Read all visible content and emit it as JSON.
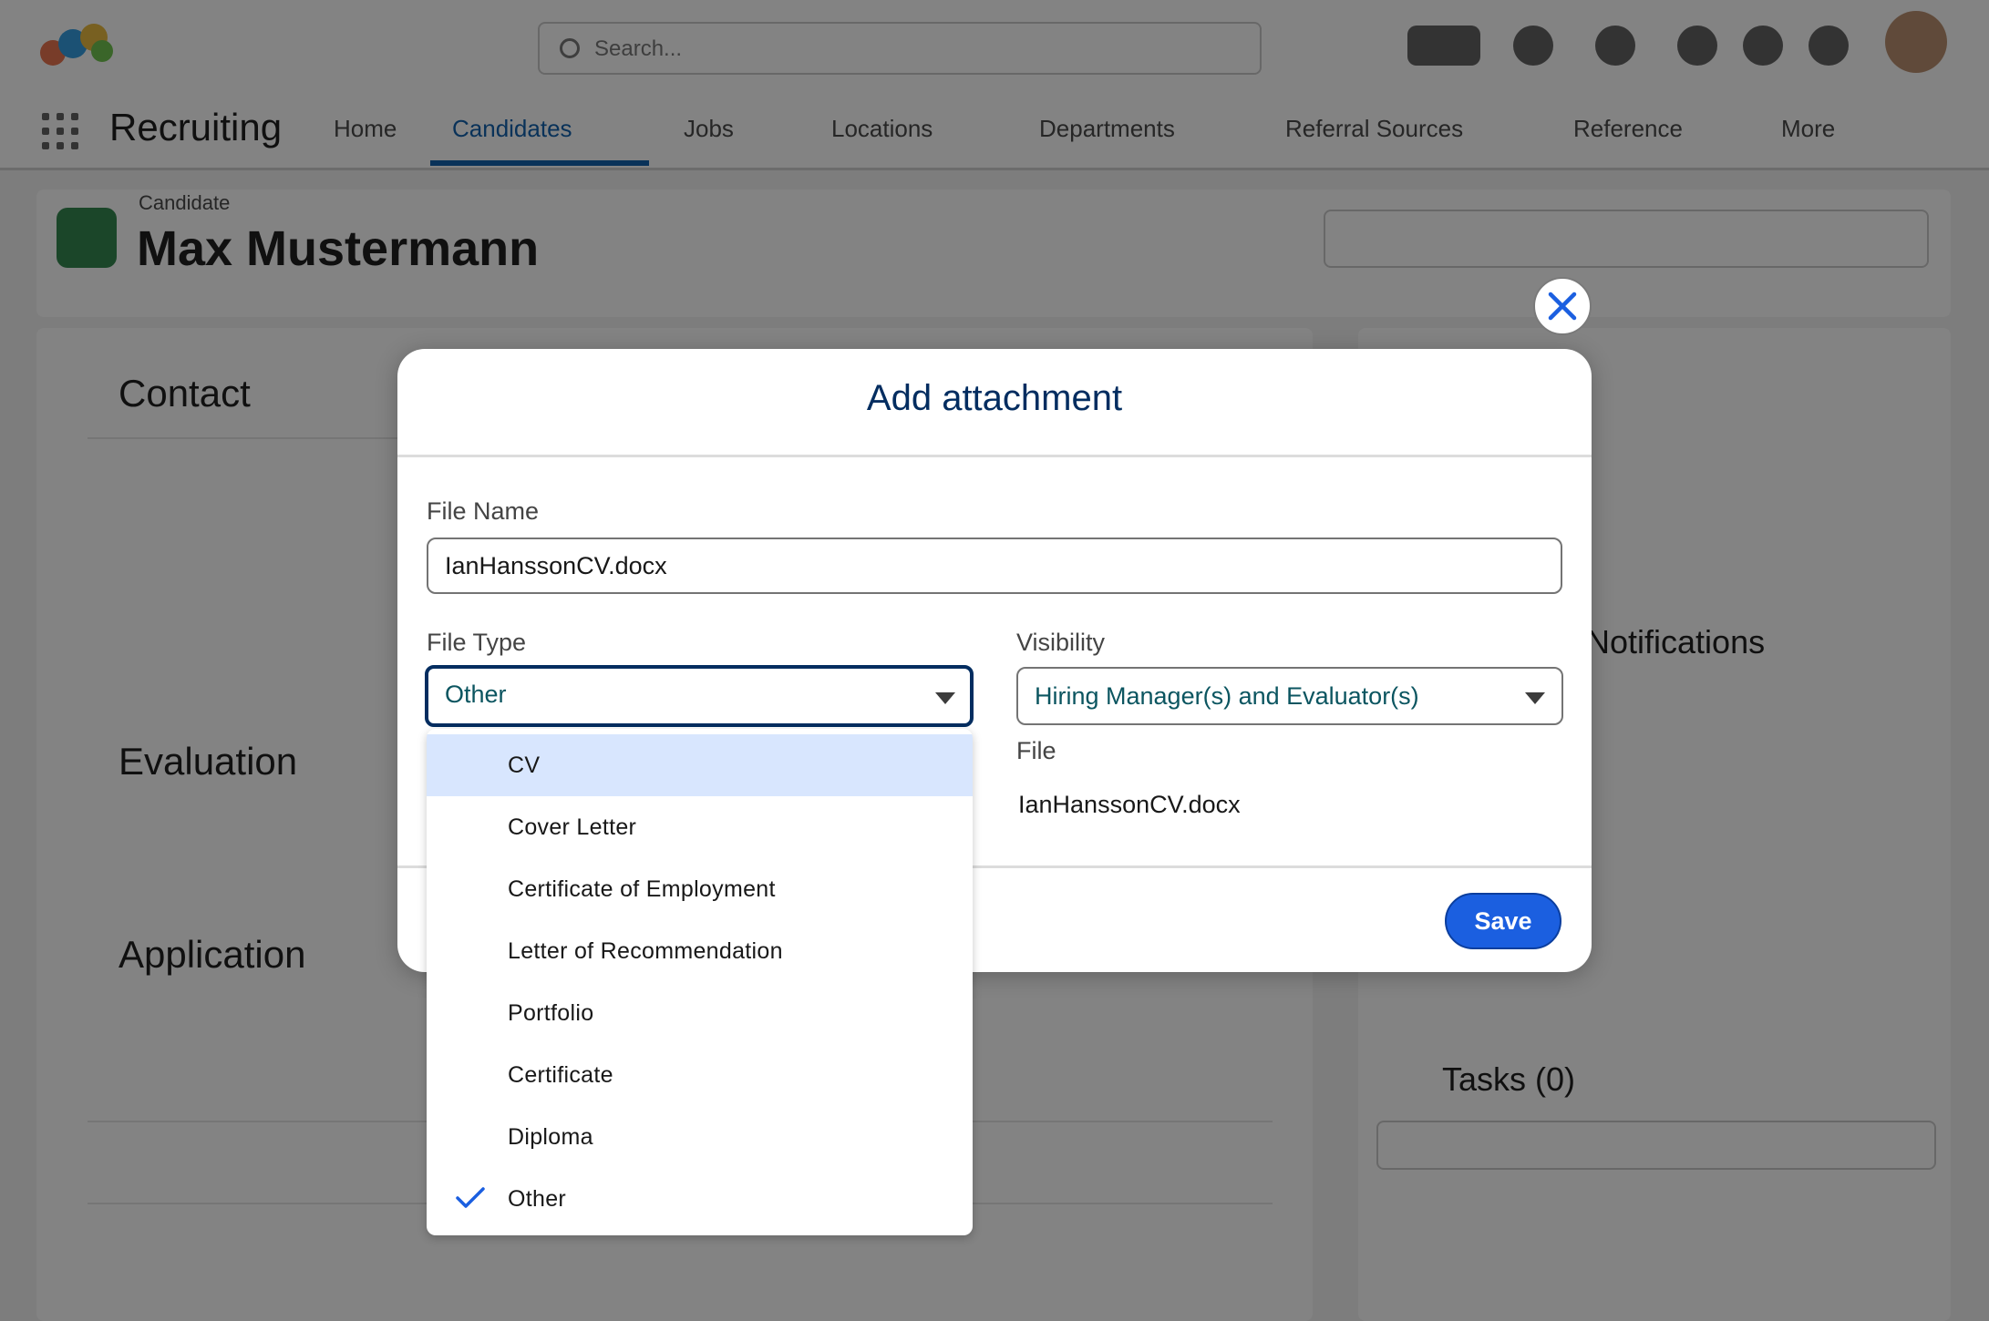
{
  "background": {
    "app_name": "Recruiting",
    "search_placeholder": "Search...",
    "nav_items": [
      "Home",
      "Candidates",
      "Jobs",
      "Locations",
      "Departments",
      "Referral Sources",
      "Reference",
      "More"
    ],
    "record_type": "Candidate",
    "record_name": "Max Mustermann",
    "sections": [
      "Contact",
      "Evaluation",
      "Application"
    ],
    "right_sections": [
      "Notifications",
      "Tasks (0)"
    ]
  },
  "modal": {
    "title": "Add attachment",
    "file_name_label": "File Name",
    "file_name_value": "IanHanssonCV.docx",
    "file_type_label": "File Type",
    "file_type_value": "Other",
    "visibility_label": "Visibility",
    "visibility_value": "Hiring Manager(s) and Evaluator(s)",
    "file_label": "File",
    "file_value": "IanHanssonCV.docx",
    "save_label": "Save"
  },
  "dropdown": {
    "options": [
      "CV",
      "Cover Letter",
      "Certificate of Employment",
      "Letter of Recommendation",
      "Portfolio",
      "Certificate",
      "Diploma",
      "Other"
    ],
    "highlighted": "CV",
    "selected": "Other"
  },
  "colors": {
    "accent": "#1b5fe0",
    "title": "#032d60",
    "highlight": "#d8e6fe",
    "check": "#1b5fe0"
  }
}
